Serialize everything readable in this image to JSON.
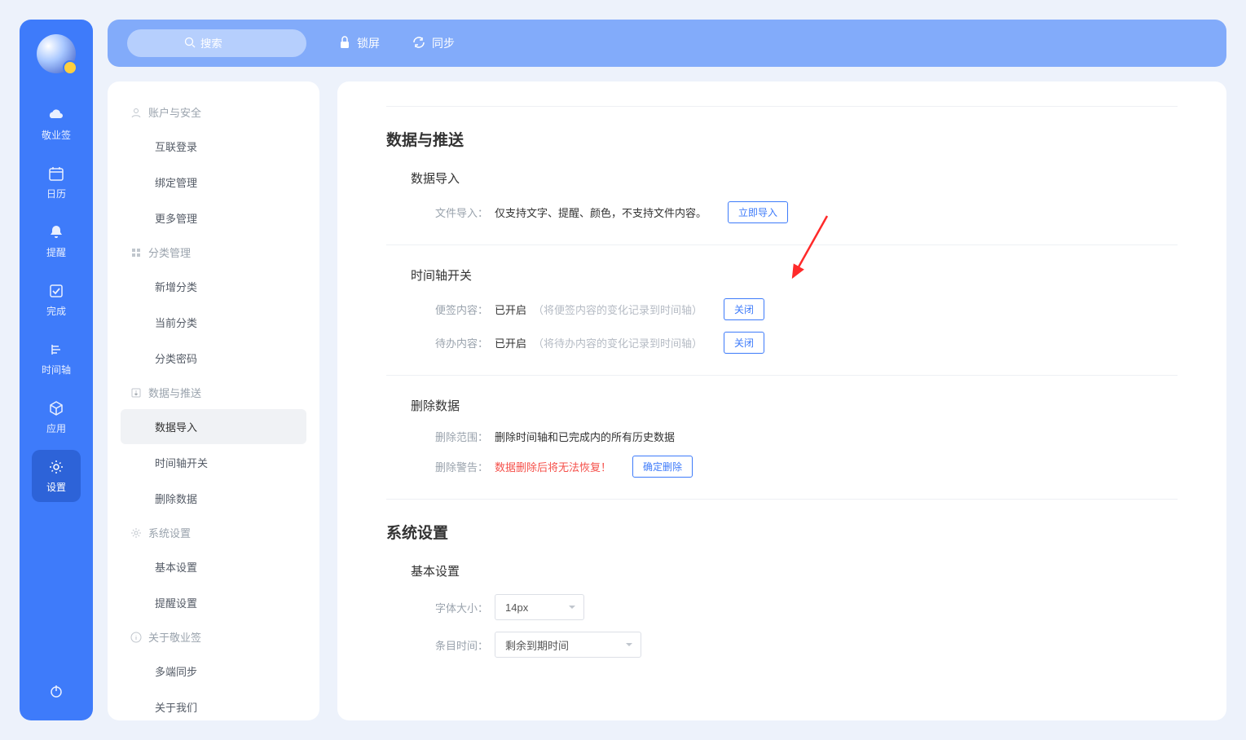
{
  "topbar": {
    "search_placeholder": "搜索",
    "lock": "锁屏",
    "sync": "同步"
  },
  "nav": {
    "items": [
      {
        "key": "notes",
        "label": "敬业签"
      },
      {
        "key": "calendar",
        "label": "日历"
      },
      {
        "key": "remind",
        "label": "提醒"
      },
      {
        "key": "done",
        "label": "完成"
      },
      {
        "key": "timeline",
        "label": "时间轴"
      },
      {
        "key": "apps",
        "label": "应用"
      },
      {
        "key": "settings",
        "label": "设置"
      }
    ],
    "active": "settings"
  },
  "settings_nav": {
    "groups": [
      {
        "title": "账户与安全",
        "icon": "user",
        "items": [
          "互联登录",
          "绑定管理",
          "更多管理"
        ]
      },
      {
        "title": "分类管理",
        "icon": "grid",
        "items": [
          "新增分类",
          "当前分类",
          "分类密码"
        ]
      },
      {
        "title": "数据与推送",
        "icon": "export",
        "items": [
          "数据导入",
          "时间轴开关",
          "删除数据"
        ]
      },
      {
        "title": "系统设置",
        "icon": "gear",
        "items": [
          "基本设置",
          "提醒设置"
        ]
      },
      {
        "title": "关于敬业签",
        "icon": "info",
        "items": [
          "多端同步",
          "关于我们"
        ]
      }
    ],
    "active": "数据导入"
  },
  "panel": {
    "section1_title": "数据与推送",
    "import": {
      "title": "数据导入",
      "label": "文件导入：",
      "desc": "仅支持文字、提醒、颜色，不支持文件内容。",
      "btn": "立即导入"
    },
    "timeline": {
      "title": "时间轴开关",
      "row1_label": "便签内容：",
      "row1_val": "已开启",
      "row1_hint": "（将便签内容的变化记录到时间轴）",
      "row2_label": "待办内容：",
      "row2_val": "已开启",
      "row2_hint": "（将待办内容的变化记录到时间轴）",
      "btn": "关闭"
    },
    "delete": {
      "title": "删除数据",
      "scope_label": "删除范围：",
      "scope_val": "删除时间轴和已完成内的所有历史数据",
      "warn_label": "删除警告：",
      "warn_text": "数据删除后将无法恢复！",
      "btn": "确定删除"
    },
    "section2_title": "系统设置",
    "basic": {
      "title": "基本设置",
      "font_label": "字体大小：",
      "font_val": "14px",
      "time_label": "条目时间：",
      "time_val": "剩余到期时间"
    }
  }
}
